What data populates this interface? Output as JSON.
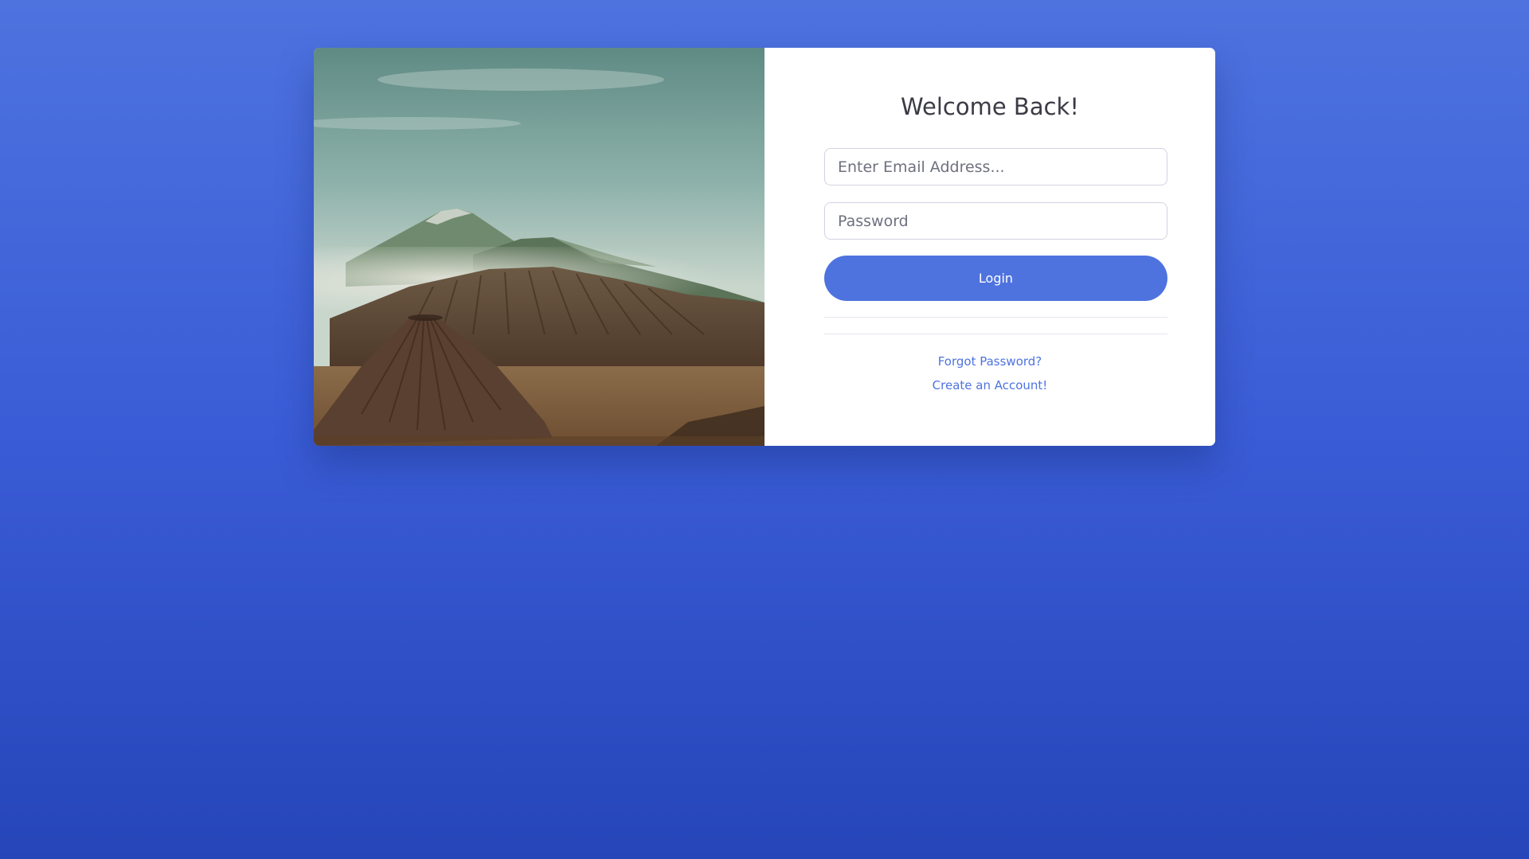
{
  "login_card": {
    "title": "Welcome Back!",
    "email": {
      "placeholder": "Enter Email Address..."
    },
    "password": {
      "placeholder": "Password"
    },
    "login_label": "Login",
    "forgot_link": "Forgot Password?",
    "create_link": "Create an Account!"
  },
  "colors": {
    "brand": "#4e73df",
    "background_top": "#4e73df",
    "background_bottom": "#2545b9",
    "title_text": "#3a3b45",
    "input_text": "#6e707e"
  }
}
